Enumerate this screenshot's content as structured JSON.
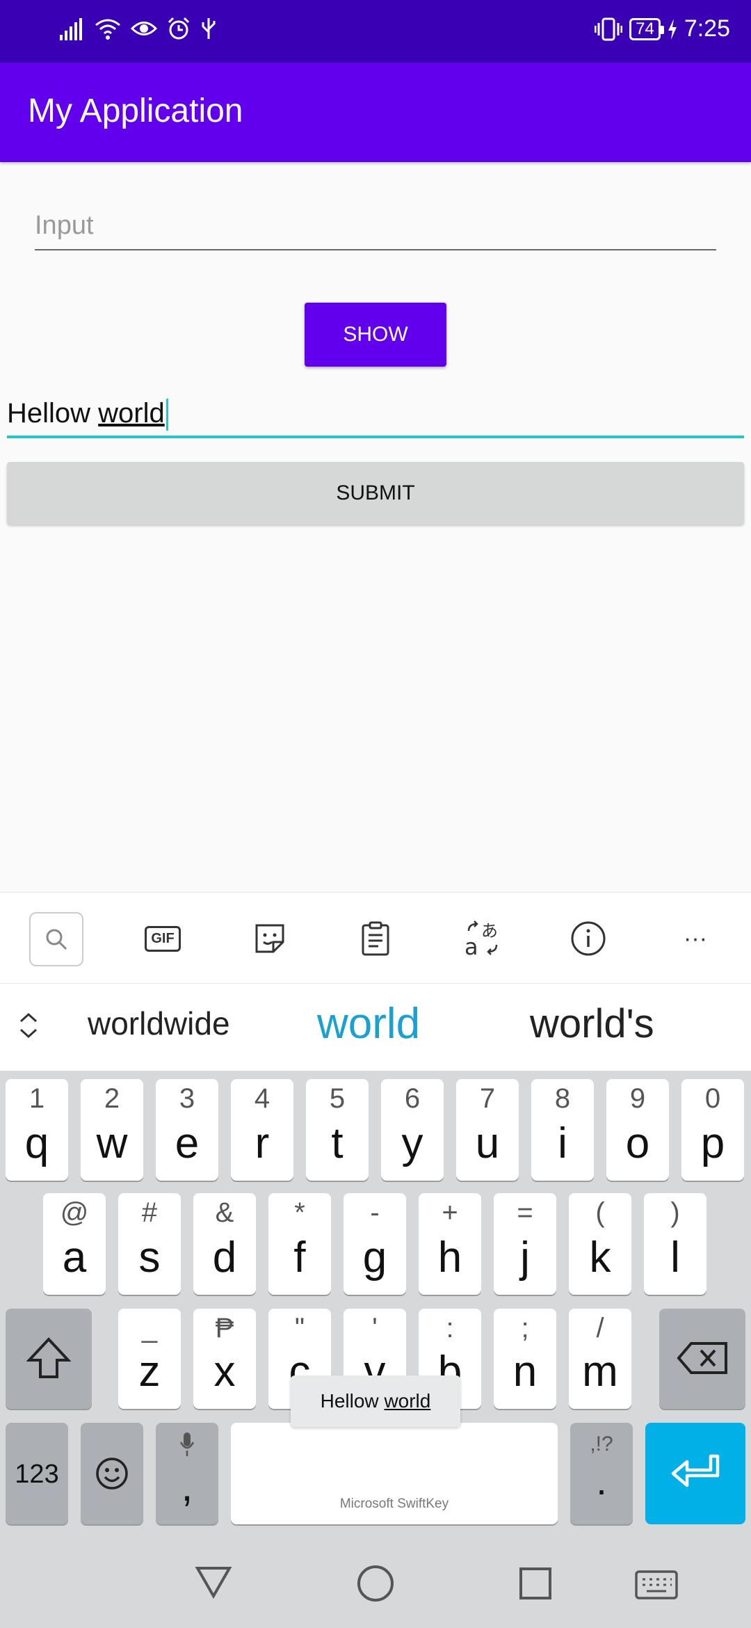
{
  "status_bar": {
    "battery": "74",
    "time": "7:25"
  },
  "app_bar": {
    "title": "My Application"
  },
  "form": {
    "input_placeholder": "Input",
    "show_label": "SHOW",
    "text_field_value_prefix": "Hellow ",
    "text_field_value_underlined": "world",
    "submit_label": "SUBMIT"
  },
  "keyboard": {
    "toolbar": [
      "search-icon",
      "gif-icon",
      "sticker-icon",
      "clipboard-icon",
      "translate-icon",
      "info-icon",
      "more-icon"
    ],
    "toolbar_gif_label": "GIF",
    "toolbar_more_label": "···",
    "suggestions": [
      "worldwide",
      "world",
      "world's"
    ],
    "row1": [
      {
        "main": "q",
        "sub": "1"
      },
      {
        "main": "w",
        "sub": "2"
      },
      {
        "main": "e",
        "sub": "3"
      },
      {
        "main": "r",
        "sub": "4"
      },
      {
        "main": "t",
        "sub": "5"
      },
      {
        "main": "y",
        "sub": "6"
      },
      {
        "main": "u",
        "sub": "7"
      },
      {
        "main": "i",
        "sub": "8"
      },
      {
        "main": "o",
        "sub": "9"
      },
      {
        "main": "p",
        "sub": "0"
      }
    ],
    "row2": [
      {
        "main": "a",
        "sub": "@"
      },
      {
        "main": "s",
        "sub": "#"
      },
      {
        "main": "d",
        "sub": "&"
      },
      {
        "main": "f",
        "sub": "*"
      },
      {
        "main": "g",
        "sub": "-"
      },
      {
        "main": "h",
        "sub": "+"
      },
      {
        "main": "j",
        "sub": "="
      },
      {
        "main": "k",
        "sub": "("
      },
      {
        "main": "l",
        "sub": ")"
      }
    ],
    "row3": [
      {
        "main": "z",
        "sub": "_"
      },
      {
        "main": "x",
        "sub": "₱"
      },
      {
        "main": "c",
        "sub": "\""
      },
      {
        "main": "v",
        "sub": "'"
      },
      {
        "main": "b",
        "sub": ":"
      },
      {
        "main": "n",
        "sub": ";"
      },
      {
        "main": "m",
        "sub": "/"
      }
    ],
    "numbers_label": "123",
    "comma_label": ",",
    "period_label": ".",
    "period_sub": ",!?",
    "space_label": "Microsoft SwiftKey",
    "tooltip_prefix": "Hellow ",
    "tooltip_underlined": "world"
  },
  "colors": {
    "status_bar": "#3a00b4",
    "app_bar": "#6200ee",
    "accent": "#26c6c6",
    "enter": "#00b0e6",
    "suggestion_highlight": "#1ba0d2"
  }
}
